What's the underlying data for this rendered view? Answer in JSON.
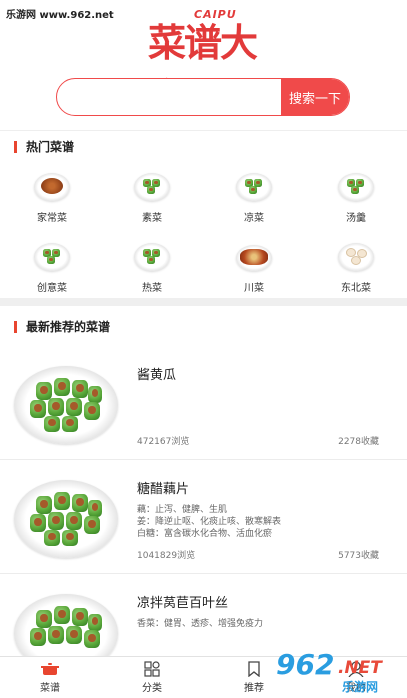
{
  "watermark_top": "乐游网 www.962.net",
  "logo": {
    "cn": "菜谱大全",
    "en": "CAIPU"
  },
  "search": {
    "placeholder": "",
    "button": "搜索一下"
  },
  "hot": {
    "title": "热门菜谱",
    "categories": [
      "家常菜",
      "素菜",
      "凉菜",
      "汤羹",
      "创意菜",
      "热菜",
      "川菜",
      "东北菜"
    ]
  },
  "latest": {
    "title": "最新推荐的菜谱",
    "items": [
      {
        "name": "酱黄瓜",
        "desc": "",
        "views": "472167浏览",
        "favs": "2278收藏"
      },
      {
        "name": "糖醋藕片",
        "desc": "藕：止泻、健脾、生肌\n姜：降逆止呕、化痰止咳、散寒解表\n白糖：富含碳水化合物、活血化瘀",
        "views": "1041829浏览",
        "favs": "5773收藏"
      },
      {
        "name": "凉拌莴苣百叶丝",
        "desc": "香菜：健胃、透疹、增强免疫力",
        "views": "",
        "favs": ""
      }
    ]
  },
  "tabbar": {
    "tabs": [
      "菜谱",
      "分类",
      "推荐",
      "我的"
    ]
  },
  "watermark_bottom": {
    "big": "962",
    "net": ".NET",
    "sub": "乐游网"
  },
  "colors": {
    "accent": "#f04a4a",
    "brand_blue": "#2a9de0"
  }
}
